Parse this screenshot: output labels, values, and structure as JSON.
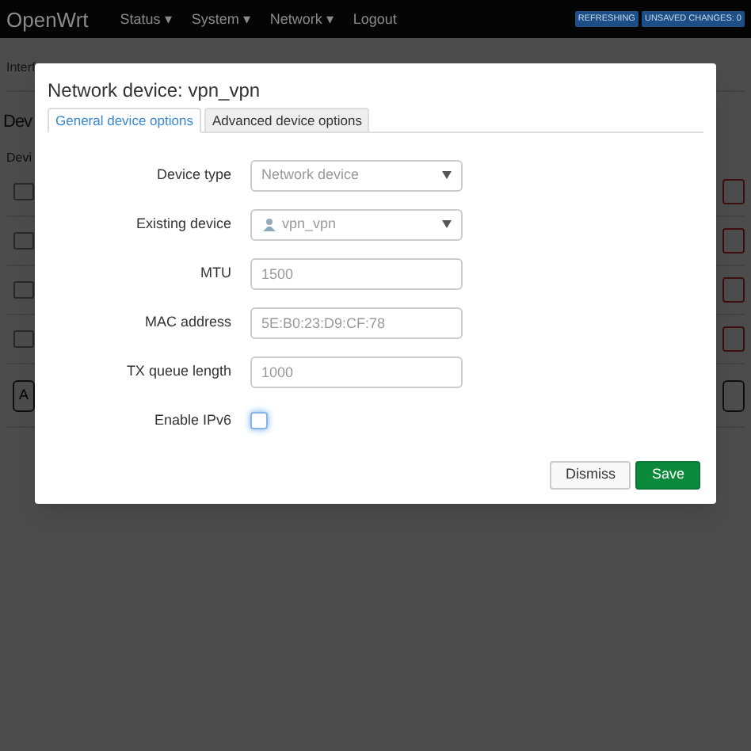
{
  "navbar": {
    "brand": "OpenWrt",
    "menus": [
      {
        "label": "Status",
        "caret": "▾"
      },
      {
        "label": "System",
        "caret": "▾"
      },
      {
        "label": "Network",
        "caret": "▾"
      },
      {
        "label": "Logout"
      }
    ],
    "badges": [
      "REFRESHING",
      "UNSAVED CHANGES: 0"
    ]
  },
  "background_page": {
    "tab": "Interf",
    "heading": "Dev",
    "column_header": "Devi",
    "add_button": "A"
  },
  "dialog": {
    "title": "Network device: vpn_vpn",
    "tabs": [
      {
        "label": "General device options",
        "selected": true
      },
      {
        "label": "Advanced device options",
        "selected": false
      }
    ],
    "fields": [
      {
        "kind": "select",
        "label": "Device type",
        "value": "Network device"
      },
      {
        "kind": "device-select",
        "label": "Existing device",
        "value": "vpn_vpn"
      },
      {
        "kind": "text",
        "label": "MTU",
        "placeholder": "1500"
      },
      {
        "kind": "text",
        "label": "MAC address",
        "placeholder": "5E:B0:23:D9:CF:78"
      },
      {
        "kind": "text",
        "label": "TX queue length",
        "placeholder": "1000"
      },
      {
        "kind": "checkbox",
        "label": "Enable IPv6",
        "checked": false
      }
    ],
    "buttons": [
      {
        "kind": "secondary",
        "label": "Dismiss"
      },
      {
        "kind": "primary",
        "label": "Save"
      }
    ]
  }
}
